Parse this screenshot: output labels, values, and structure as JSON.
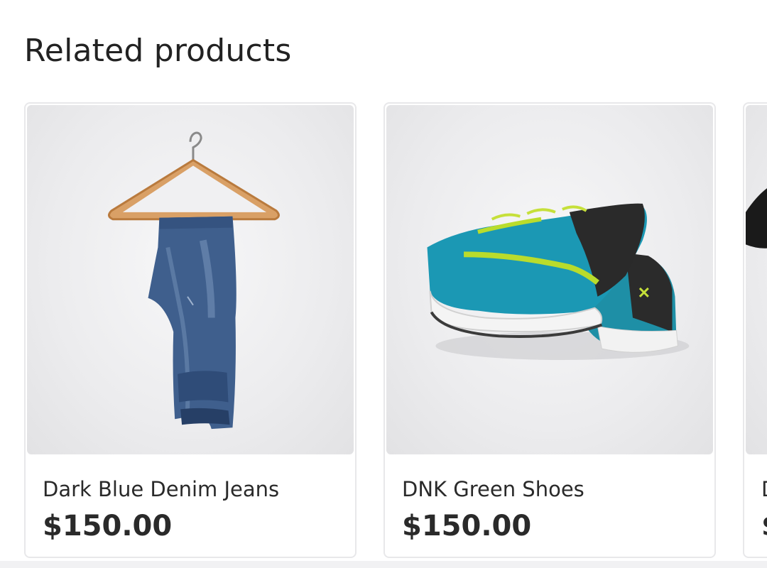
{
  "section": {
    "title": "Related products"
  },
  "products": [
    {
      "title": "Dark Blue Denim Jeans",
      "price": "$150.00",
      "image": "denim-jeans-on-hanger"
    },
    {
      "title": "DNK Green Shoes",
      "price": "$150.00",
      "image": "green-sneakers"
    },
    {
      "title": "D",
      "price": "$",
      "image": "black-shoe-partial"
    }
  ],
  "colors": {
    "card_border": "#e8e8ea",
    "text": "#222222",
    "image_background": "#ececee"
  }
}
